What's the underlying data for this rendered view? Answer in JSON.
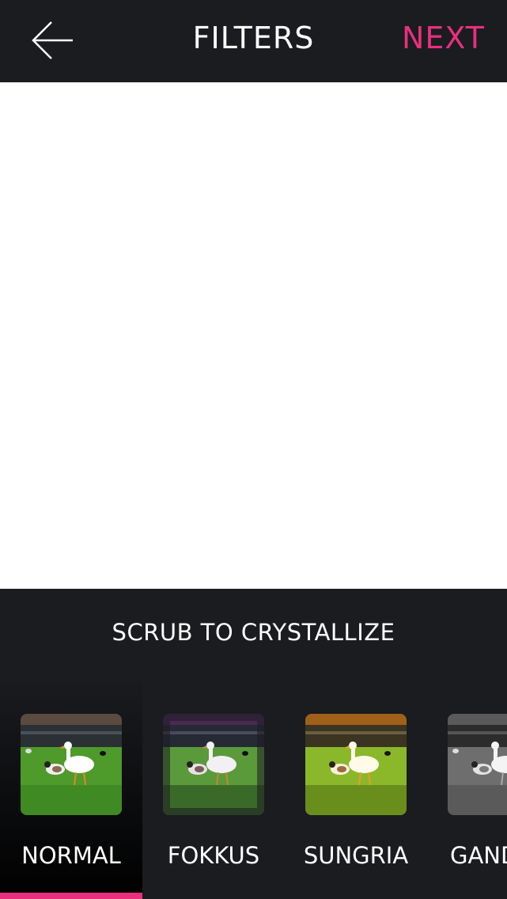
{
  "header": {
    "back_icon": "arrow-left-icon",
    "title": "FILTERS",
    "next_label": "NEXT",
    "accent_color": "#ea2f7d"
  },
  "panel": {
    "hint": "SCRUB TO CRYSTALLIZE",
    "filters": [
      {
        "label": "NORMAL",
        "selected": true
      },
      {
        "label": "FOKKUS",
        "selected": false
      },
      {
        "label": "SUNGRIA",
        "selected": false
      },
      {
        "label": "GAND",
        "selected": false
      }
    ]
  }
}
